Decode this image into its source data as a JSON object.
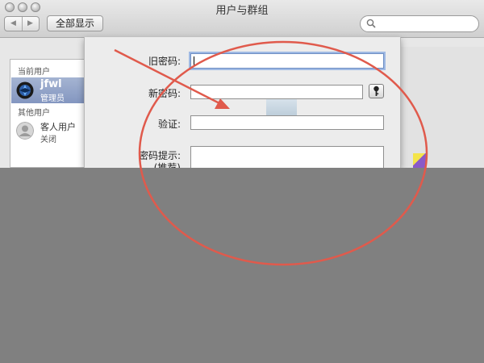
{
  "window": {
    "title": "用户与群组",
    "nav": {
      "back": "◀",
      "forward": "▶"
    },
    "show_all_label": "全部显示",
    "search": {
      "placeholder": "",
      "value": ""
    }
  },
  "sidebar": {
    "current_section": "当前用户",
    "current_user": {
      "name": "jfwl",
      "role": "管理员"
    },
    "other_section": "其他用户",
    "guest_user": {
      "name": "客人用户",
      "status": "关闭"
    }
  },
  "sheet": {
    "old_password_label": "旧密码:",
    "new_password_label": "新密码:",
    "verify_label": "验证:",
    "hint_label": "密码提示:",
    "hint_sub_label": "(推荐)",
    "old_password_value": "",
    "new_password_value": "",
    "verify_value": "",
    "hint_value": ""
  },
  "annotation": {
    "arrow_color": "#e05a4c",
    "circle_color": "#e05a4c"
  },
  "colors": {
    "page_background": "#808080",
    "selection": "#8fa0c6"
  }
}
